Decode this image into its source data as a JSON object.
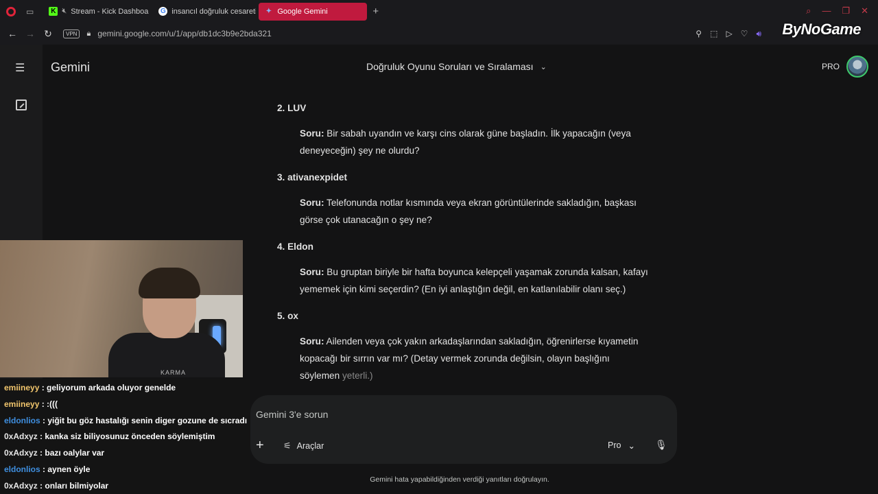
{
  "browser": {
    "tabs": [
      {
        "label": "Stream - Kick Dashboa",
        "icon": "kick-icon"
      },
      {
        "label": "insancıl doğruluk cesareti",
        "icon": "google-icon"
      },
      {
        "label": "Google Gemini",
        "icon": "gemini-icon",
        "active": true
      }
    ],
    "vpn": "VPN",
    "url": "gemini.google.com/u/1/app/db1dc3b9e2bda321",
    "watermark": "ByNoGame"
  },
  "app": {
    "title": "Gemini",
    "conversation_title": "Doğruluk Oyunu Soruları ve Sıralaması",
    "pro_label": "PRO"
  },
  "items": [
    {
      "head": "2. LUV",
      "label": "Soru:",
      "text": "Bir sabah uyandın ve karşı cins olarak güne başladın. İlk yapacağın (veya deneyeceğin) şey ne olurdu?"
    },
    {
      "head": "3. ativanexpidet",
      "label": "Soru:",
      "text": "Telefonunda notlar kısmında veya ekran görüntülerinde sakladığın, başkası görse çok utanacağın o şey ne?"
    },
    {
      "head": "4. Eldon",
      "label": "Soru:",
      "text": "Bu gruptan biriyle bir hafta boyunca kelepçeli yaşamak zorunda kalsan, kafayı yememek için kimi seçerdin? (En iyi anlaştığın değil, en katlanılabilir olanı seç.)"
    },
    {
      "head": "5. ox",
      "label": "Soru:",
      "text": "Ailenden veya çok yakın arkadaşlarından sakladığın, öğrenirlerse kıyametin kopacağı bir sırrın var mı? (Detay vermek zorunda değilsin, olayın başlığını söylemen",
      "fade_text": "yeterli.)"
    }
  ],
  "input": {
    "placeholder": "Gemini 3'e sorun",
    "tools_label": "Araçlar",
    "model_label": "Pro",
    "disclaimer": "Gemini hata yapabildiğinden verdiği yanıtları doğrulayın."
  },
  "webcam": {
    "shirt_text": "KARMA"
  },
  "chat": [
    {
      "user": "emiineyy",
      "color": "#f2c66d",
      "msg": ": geliyorum arkada oluyor genelde"
    },
    {
      "user": "emiineyy",
      "color": "#f2c66d",
      "msg": ": :((("
    },
    {
      "user": "eldonlios",
      "color": "#3f8fe0",
      "msg": ": yiğit bu göz hastalığı senin diger gozune de sıcradı"
    },
    {
      "user": "0xAdxyz",
      "color": "#e8e8e8",
      "msg": ": kanka siz biliyosunuz önceden söylemiştim"
    },
    {
      "user": "0xAdxyz",
      "color": "#e8e8e8",
      "msg": ": bazı oalylar var"
    },
    {
      "user": "eldonlios",
      "color": "#3f8fe0",
      "msg": ": aynen öyle"
    },
    {
      "user": "0xAdxyz",
      "color": "#e8e8e8",
      "msg": ": onları bilmiyolar"
    }
  ]
}
